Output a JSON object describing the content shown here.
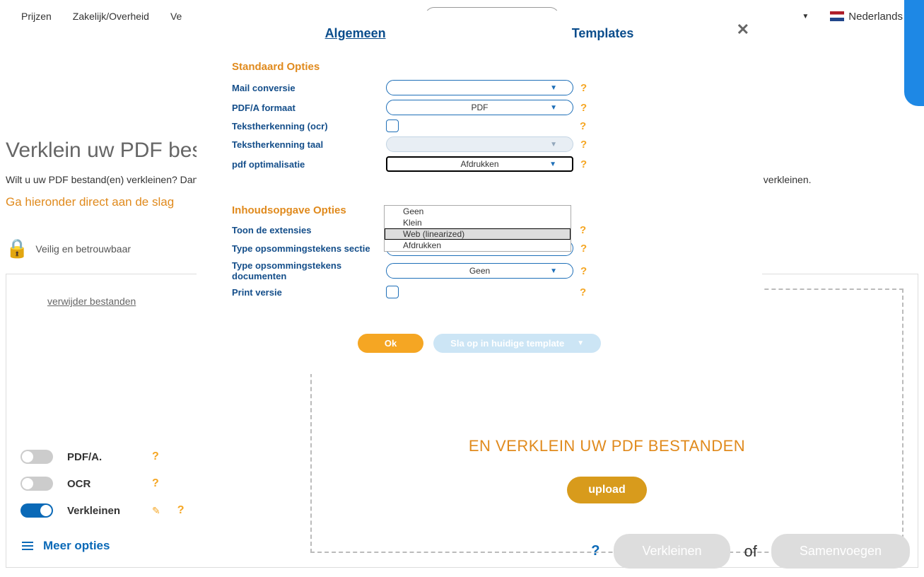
{
  "nav": {
    "items": [
      "Prijzen",
      "Zakelijk/Overheid",
      "Ve"
    ],
    "language": "Nederlands"
  },
  "hero": {
    "title": "Verklein uw PDF bestand",
    "sub_left": "Wilt u uw PDF bestand(en) verkleinen? Dan ",
    "sub_right": "n verkleinen.",
    "cta": "Ga hieronder direct aan de slag"
  },
  "secure": {
    "text": "Veilig en betrouwbaar"
  },
  "left_panel": {
    "remove": "verwijder bestanden",
    "toggles": [
      {
        "label": "PDF/A.",
        "on": false,
        "edit": false
      },
      {
        "label": "OCR",
        "on": false,
        "edit": false
      },
      {
        "label": "Verkleinen",
        "on": true,
        "edit": true
      }
    ],
    "more": "Meer opties"
  },
  "dropzone": {
    "headline": "EN VERKLEIN UW PDF BESTANDEN",
    "upload": "upload"
  },
  "actions": {
    "verkleinen": "Verkleinen",
    "of": "of",
    "samenvoegen": "Samenvoegen"
  },
  "modal": {
    "tabs": {
      "general": "Algemeen",
      "templates": "Templates"
    },
    "section1": "Standaard Opties",
    "section2": "Inhoudsopgave Opties",
    "labels": {
      "mail": "Mail conversie",
      "pdfa": "PDF/A formaat",
      "ocr": "Tekstherkenning (ocr)",
      "ocr_lang": "Tekstherkenning taal",
      "pdf_opt": "pdf optimalisatie",
      "show_ext": "Toon de extensies",
      "bullets_section": "Type opsommingstekens sectie",
      "bullets_docs": "Type opsommingstekens documenten",
      "print": "Print versie"
    },
    "values": {
      "mail": "",
      "pdfa": "PDF",
      "ocr_lang": "",
      "pdf_opt": "Afdrukken",
      "bullets_section": "Geen",
      "bullets_docs": "Geen"
    },
    "pdf_opt_options": [
      "Geen",
      "Klein",
      "Web (linearized)",
      "Afdrukken"
    ],
    "ok": "Ok",
    "save_template": "Sla op in huidige template"
  }
}
